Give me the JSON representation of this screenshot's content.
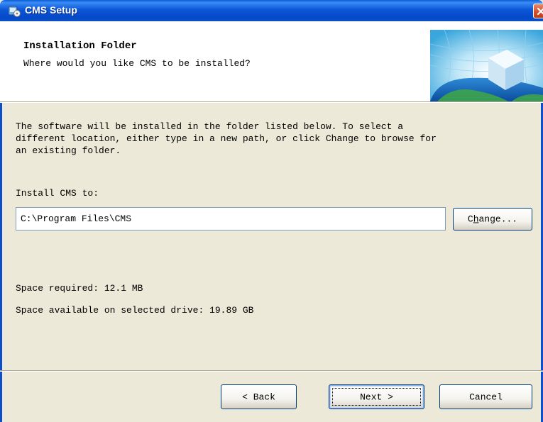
{
  "window": {
    "title": "CMS Setup"
  },
  "header": {
    "title": "Installation Folder",
    "subtitle": "Where would you like CMS to be installed?"
  },
  "body": {
    "description": "The software will be installed in the folder listed below. To select a\ndifferent location, either type in a new path, or click Change to browse for\nan existing folder.",
    "install_label": "Install CMS to:",
    "install_path": "C:\\Program Files\\CMS",
    "change_button": "Change...",
    "change_mnemonic": "h",
    "space_required": "Space required: 12.1 MB",
    "space_available": "Space available on selected drive: 19.89 GB"
  },
  "footer": {
    "back_label": "< Back",
    "next_label": "Next >",
    "cancel_label": "Cancel"
  },
  "colors": {
    "titlebar": "#0a5fd8",
    "panel": "#ece9d8",
    "close": "#d5502c"
  }
}
